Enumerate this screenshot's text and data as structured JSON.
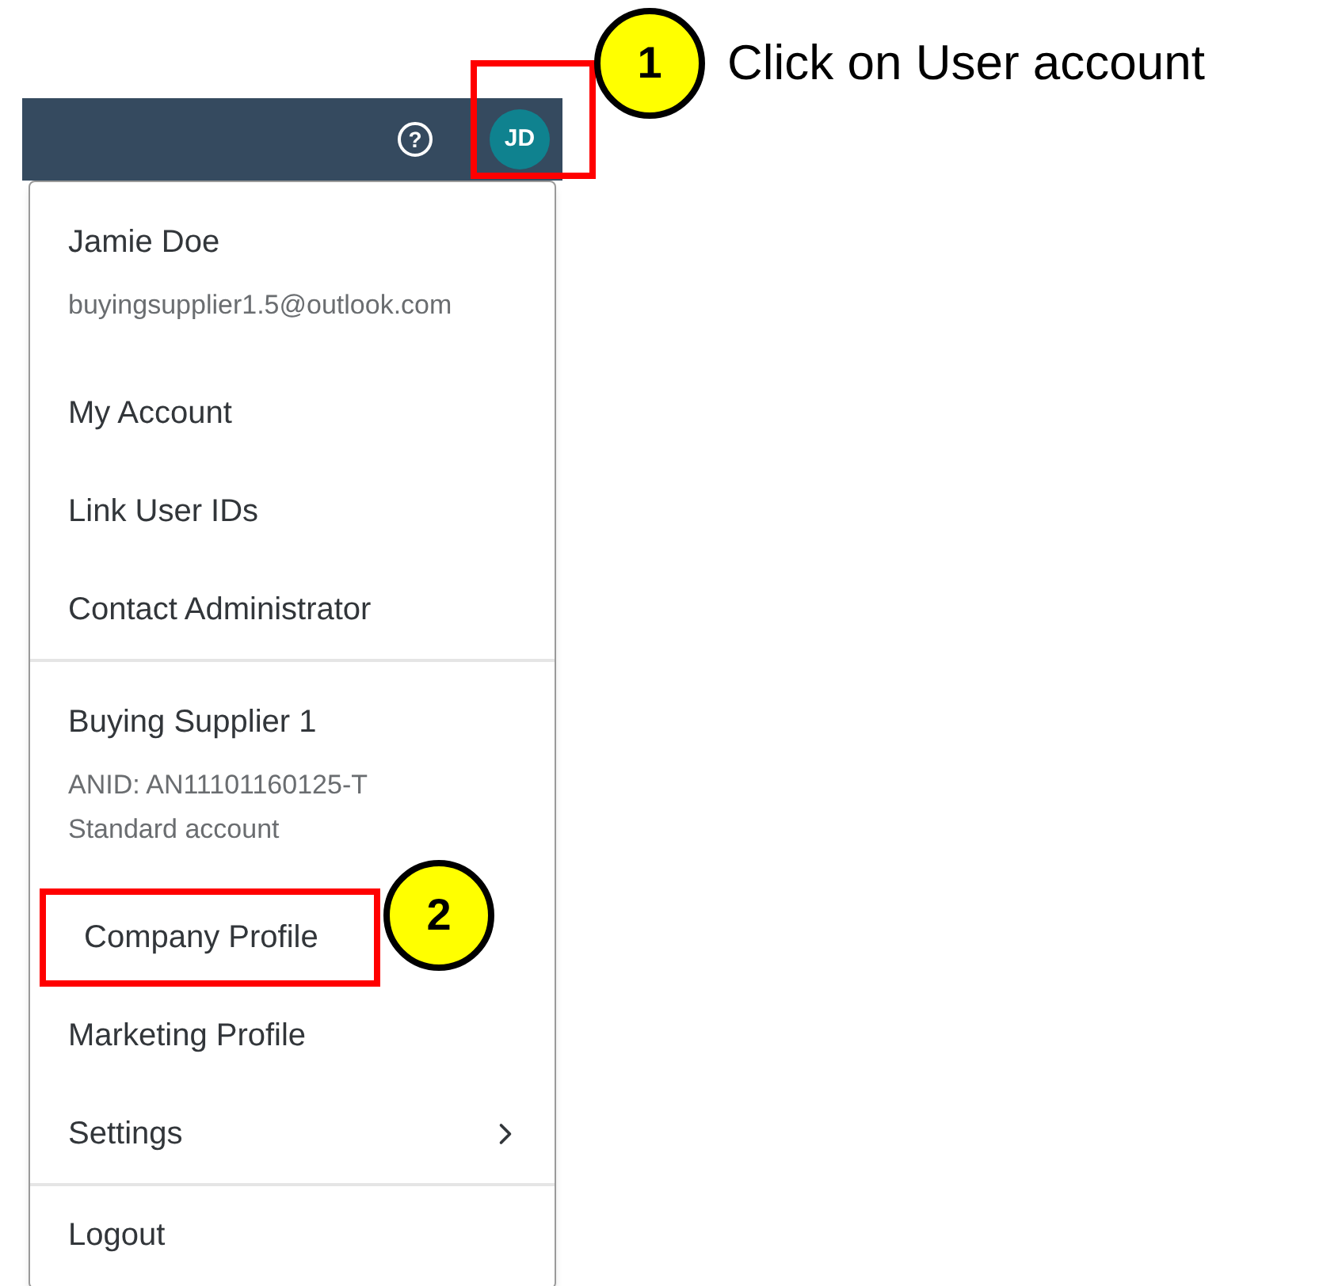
{
  "header": {
    "help_icon": "?",
    "avatar": {
      "initials": "JD",
      "highlighted": true
    }
  },
  "menu": {
    "sections": [
      {
        "items": [
          {
            "kind": "title",
            "text": "Jamie Doe",
            "highlighted": false
          },
          {
            "kind": "detail",
            "text": "buyingsupplier1.5@outlook.com",
            "highlighted": false
          },
          {
            "kind": "link",
            "text": "My Account",
            "highlighted": false
          },
          {
            "kind": "link",
            "text": "Link User IDs",
            "highlighted": false
          },
          {
            "kind": "link",
            "text": "Contact Administrator",
            "highlighted": false
          }
        ]
      },
      {
        "items": [
          {
            "kind": "title",
            "text": "Buying Supplier 1",
            "highlighted": false
          },
          {
            "kind": "detail",
            "text": "ANID: AN11101160125-T",
            "highlighted": false
          },
          {
            "kind": "detail",
            "text": "Standard account",
            "highlighted": false
          },
          {
            "kind": "link",
            "text": "Company Profile",
            "highlighted": true
          },
          {
            "kind": "link",
            "text": "Marketing Profile",
            "highlighted": false
          },
          {
            "kind": "submenu",
            "text": "Settings",
            "highlighted": false
          }
        ]
      },
      {
        "items": [
          {
            "kind": "link",
            "text": "Logout",
            "highlighted": false
          }
        ]
      }
    ]
  },
  "callouts": [
    {
      "number": "1",
      "text": "Click on User account"
    },
    {
      "number": "2"
    }
  ]
}
